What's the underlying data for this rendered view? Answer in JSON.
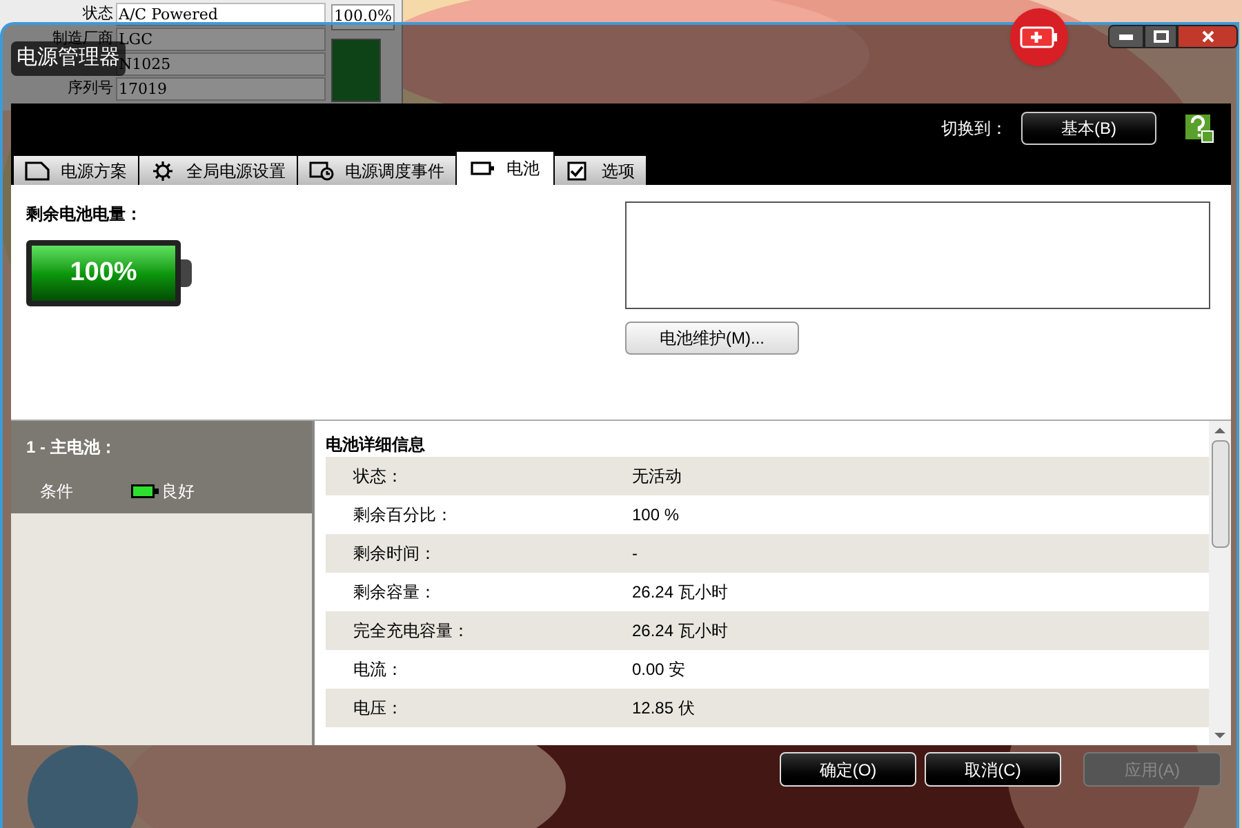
{
  "background_window": {
    "rows": [
      {
        "label": "状态",
        "value": "A/C Powered"
      },
      {
        "label": "制造厂商",
        "value": "LGC"
      },
      {
        "label": "",
        "value": "N1025"
      },
      {
        "label": "序列号",
        "value": "17019"
      }
    ],
    "reading": "100.0%"
  },
  "window": {
    "title": "电源管理器",
    "switch_label": "切换到：",
    "switch_button": "基本(B)"
  },
  "tabs": [
    {
      "label": "电源方案",
      "kind": "page",
      "selected": false
    },
    {
      "label": "全局电源设置",
      "kind": "gear",
      "selected": false
    },
    {
      "label": "电源调度事件",
      "kind": "schedule",
      "selected": false
    },
    {
      "label": "电池",
      "kind": "battery",
      "selected": true
    },
    {
      "label": "选项",
      "kind": "check",
      "selected": false
    }
  ],
  "battery": {
    "heading": "剩余电池电量：",
    "level": 1,
    "percent": "100%",
    "maintenance_button": "电池维护(M)..."
  },
  "battery_list": {
    "header": "1 - 主电池：",
    "condition_label": "条件",
    "condition_value": "良好"
  },
  "details": {
    "title": "电池详细信息",
    "rows": [
      {
        "label": "状态：",
        "value": "无活动"
      },
      {
        "label": "剩余百分比：",
        "value": "100 %"
      },
      {
        "label": "剩余时间：",
        "value": "-"
      },
      {
        "label": "剩余容量：",
        "value": "26.24 瓦小时"
      },
      {
        "label": "完全充电容量：",
        "value": "26.24 瓦小时"
      },
      {
        "label": "电流：",
        "value": "0.00 安"
      },
      {
        "label": "电压：",
        "value": "12.85 伏"
      }
    ]
  },
  "buttons": [
    {
      "label": "确定(O)",
      "disabled": false
    },
    {
      "label": "取消(C)",
      "disabled": false
    },
    {
      "label": "应用(A)",
      "disabled": true
    }
  ]
}
